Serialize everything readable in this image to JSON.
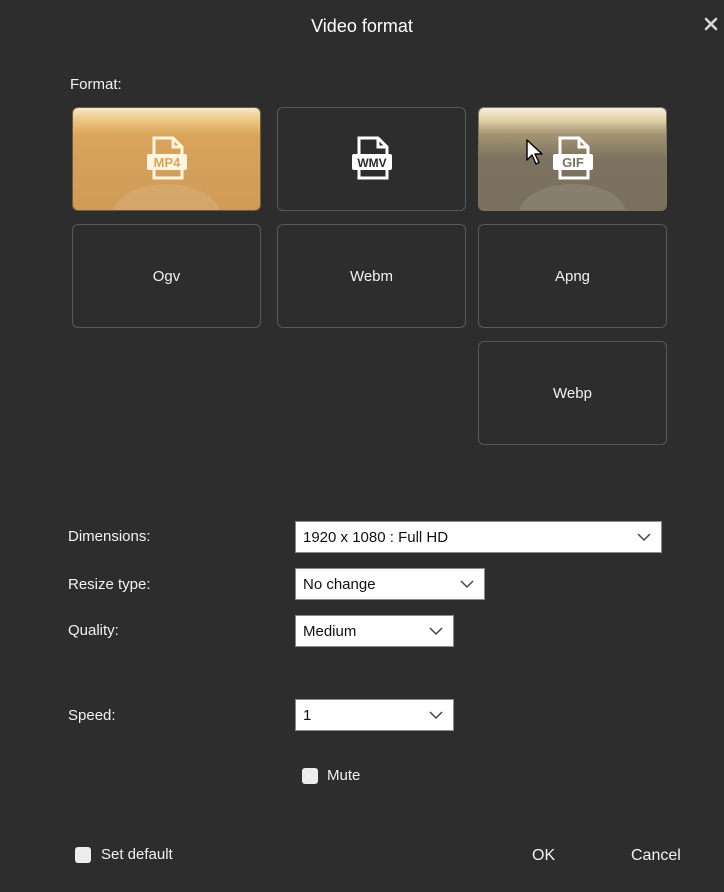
{
  "dialog": {
    "title": "Video format",
    "close_icon": "close-icon"
  },
  "format": {
    "label": "Format:",
    "tiles": [
      {
        "name": "MP4",
        "icon": "mp4-file-icon",
        "state": "selected"
      },
      {
        "name": "WMV",
        "icon": "wmv-file-icon",
        "state": "normal"
      },
      {
        "name": "GIF",
        "icon": "gif-file-icon",
        "state": "hover"
      },
      {
        "name": "Ogv",
        "label": "Ogv"
      },
      {
        "name": "Webm",
        "label": "Webm"
      },
      {
        "name": "Apng",
        "label": "Apng"
      },
      {
        "name": "Webp",
        "label": "Webp"
      }
    ],
    "icon_texts": {
      "mp4": "MP4",
      "wmv": "WMV",
      "gif": "GIF"
    }
  },
  "settings": {
    "dimensions": {
      "label": "Dimensions:",
      "value": "1920 x 1080 : Full HD"
    },
    "resize_type": {
      "label": "Resize type:",
      "value": "No change"
    },
    "quality": {
      "label": "Quality:",
      "value": "Medium"
    },
    "speed": {
      "label": "Speed:",
      "value": "1"
    },
    "mute": {
      "label": "Mute",
      "checked": false
    }
  },
  "footer": {
    "set_default": {
      "label": "Set default",
      "checked": false
    },
    "ok": "OK",
    "cancel": "Cancel"
  },
  "colors": {
    "background": "#2d2d2d",
    "selected_tile": "#d9a55a",
    "hover_tile": "#7c7260",
    "text": "#f2f2f2"
  }
}
